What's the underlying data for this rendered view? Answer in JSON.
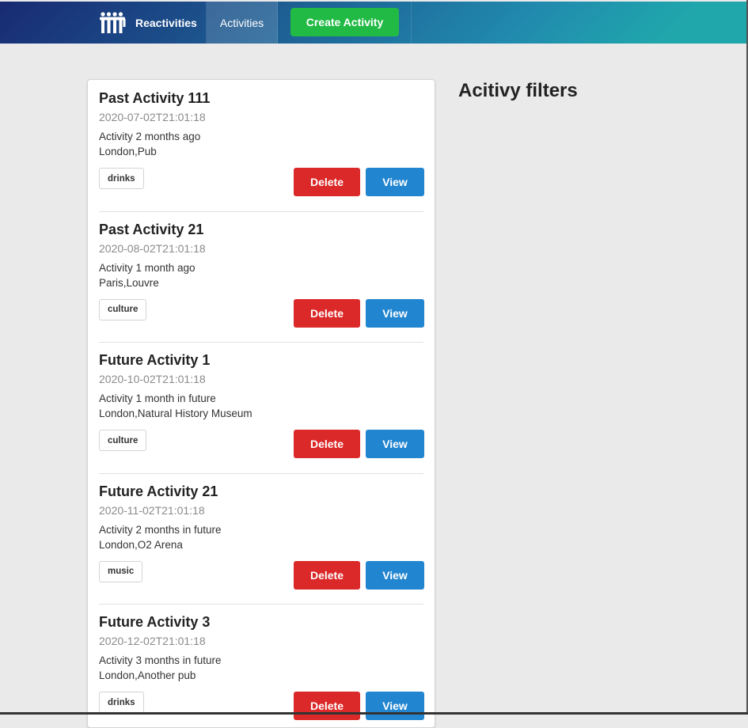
{
  "navbar": {
    "brand": "Reactivities",
    "activities": "Activities",
    "create": "Create Activity"
  },
  "activities": [
    {
      "title": "Past Activity 111",
      "date": "2020-07-02T21:01:18",
      "description": "Activity 2 months ago",
      "venue": "London,Pub",
      "category": "drinks",
      "delete_label": "Delete",
      "view_label": "View"
    },
    {
      "title": "Past Activity 21",
      "date": "2020-08-02T21:01:18",
      "description": "Activity 1 month ago",
      "venue": "Paris,Louvre",
      "category": "culture",
      "delete_label": "Delete",
      "view_label": "View"
    },
    {
      "title": "Future Activity 1",
      "date": "2020-10-02T21:01:18",
      "description": "Activity 1 month in future",
      "venue": "London,Natural History Museum",
      "category": "culture",
      "delete_label": "Delete",
      "view_label": "View"
    },
    {
      "title": "Future Activity 21",
      "date": "2020-11-02T21:01:18",
      "description": "Activity 2 months in future",
      "venue": "London,O2 Arena",
      "category": "music",
      "delete_label": "Delete",
      "view_label": "View"
    },
    {
      "title": "Future Activity 3",
      "date": "2020-12-02T21:01:18",
      "description": "Activity 3 months in future",
      "venue": "London,Another pub",
      "category": "drinks",
      "delete_label": "Delete",
      "view_label": "View"
    }
  ],
  "filters": {
    "title": "Acitivy filters"
  },
  "colors": {
    "delete": "#db2828",
    "view": "#2185d0",
    "create": "#21ba45",
    "nav_gradient_start": "#182a73",
    "nav_gradient_end": "#20a7ac"
  }
}
